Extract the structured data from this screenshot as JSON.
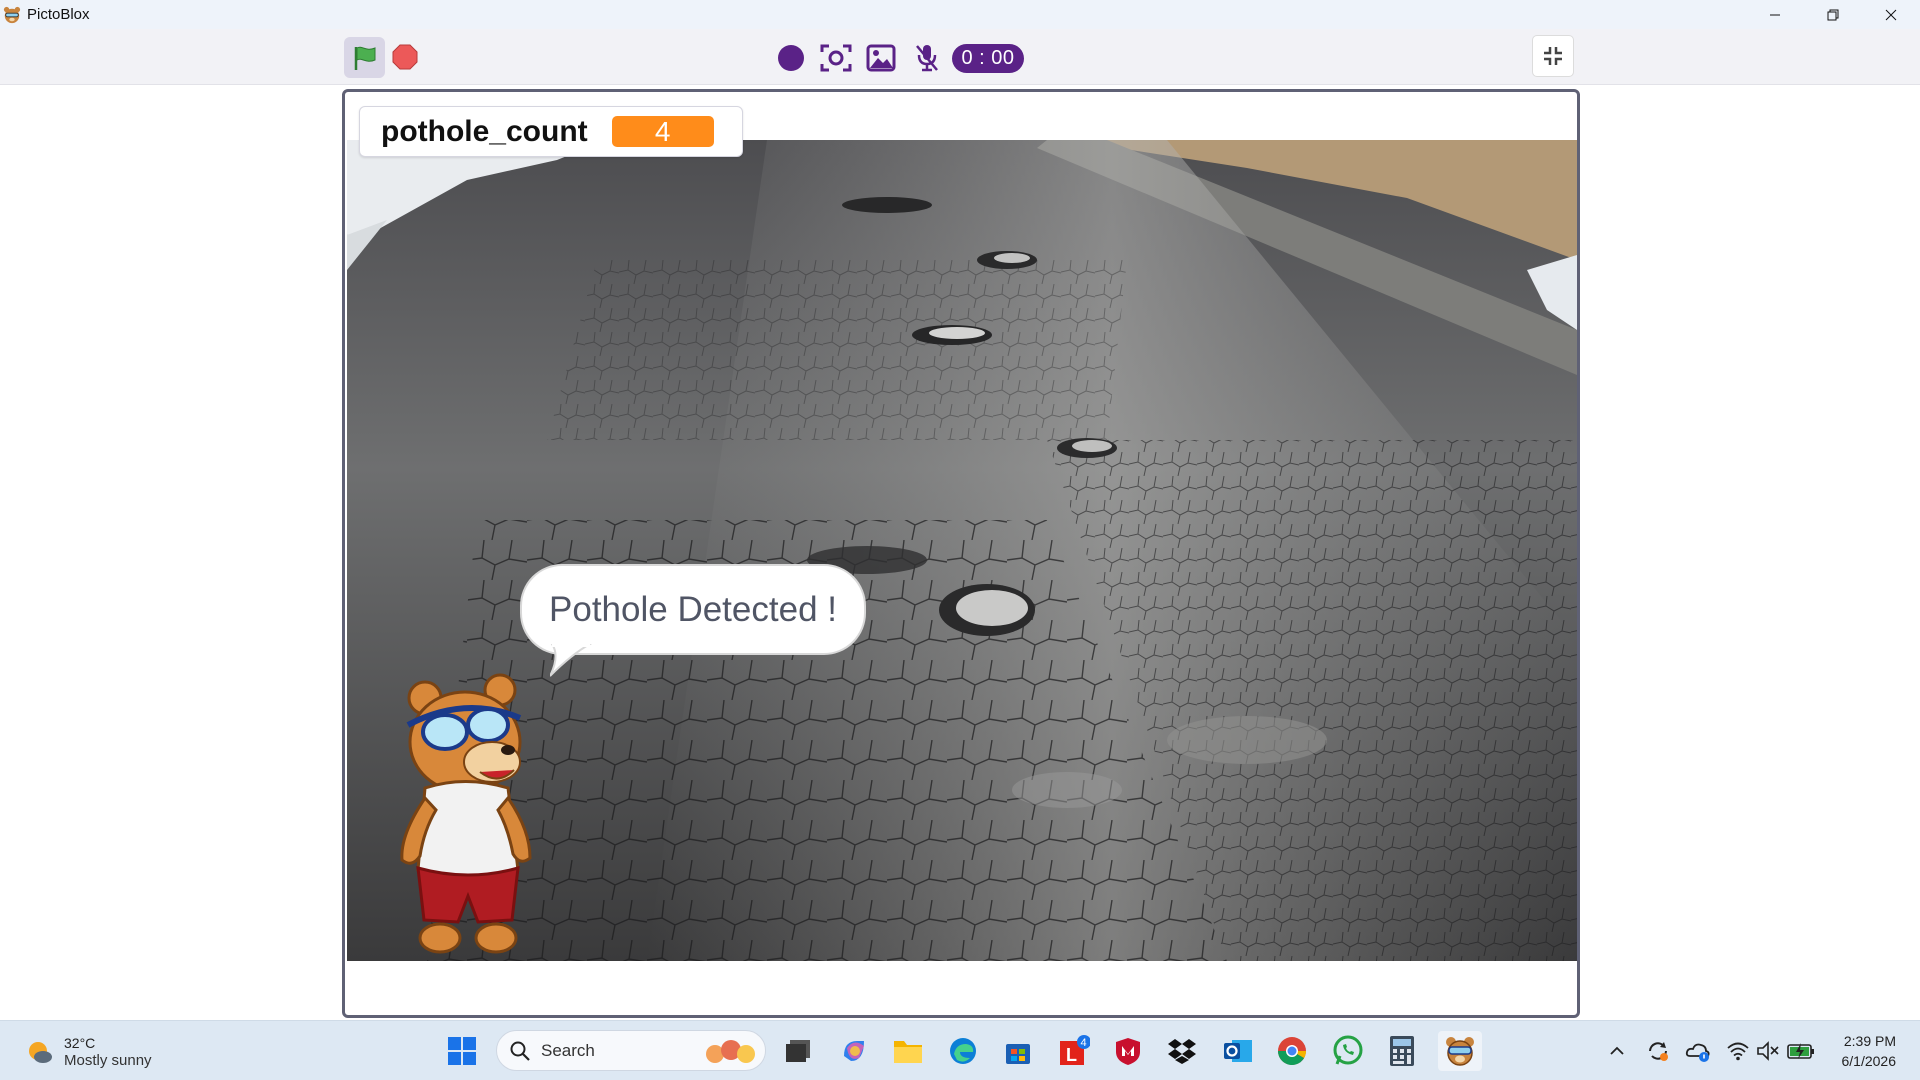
{
  "window": {
    "title": "PictoBlox",
    "minimize_icon": "minimize-icon",
    "maximize_icon": "restore-icon",
    "close_icon": "close-icon"
  },
  "toolbar": {
    "green_flag_icon": "green-flag-icon",
    "stop_icon": "stop-icon",
    "record_icon": "record-icon",
    "snapshot_icon": "camera-snapshot-icon",
    "image_icon": "image-icon",
    "mic_icon": "mic-off-icon",
    "timer": "0 : 00",
    "fullscreen_icon": "exit-fullscreen-icon"
  },
  "stage": {
    "variable": {
      "name": "pothole_count",
      "value": "4"
    },
    "speech": "Pothole Detected !",
    "colors": {
      "variable_value_bg": "#ff8c1a",
      "timer_bg": "#5a2287",
      "stage_border": "#5f6175"
    }
  },
  "taskbar": {
    "weather": {
      "temp": "32°C",
      "desc": "Mostly sunny"
    },
    "search_placeholder": "Search",
    "apps": [
      "windows-start-icon",
      "task-view-icon",
      "copilot-icon",
      "file-explorer-icon",
      "edge-icon",
      "store-icon",
      "lenovo-icon",
      "mcafee-icon",
      "dropbox-icon",
      "outlook-icon",
      "chrome-icon",
      "whatsapp-icon",
      "calculator-icon",
      "pictoblox-icon"
    ],
    "lenovo_badge": "4",
    "clock": {
      "time": "2:39 PM",
      "date": "6/1/2026"
    }
  }
}
